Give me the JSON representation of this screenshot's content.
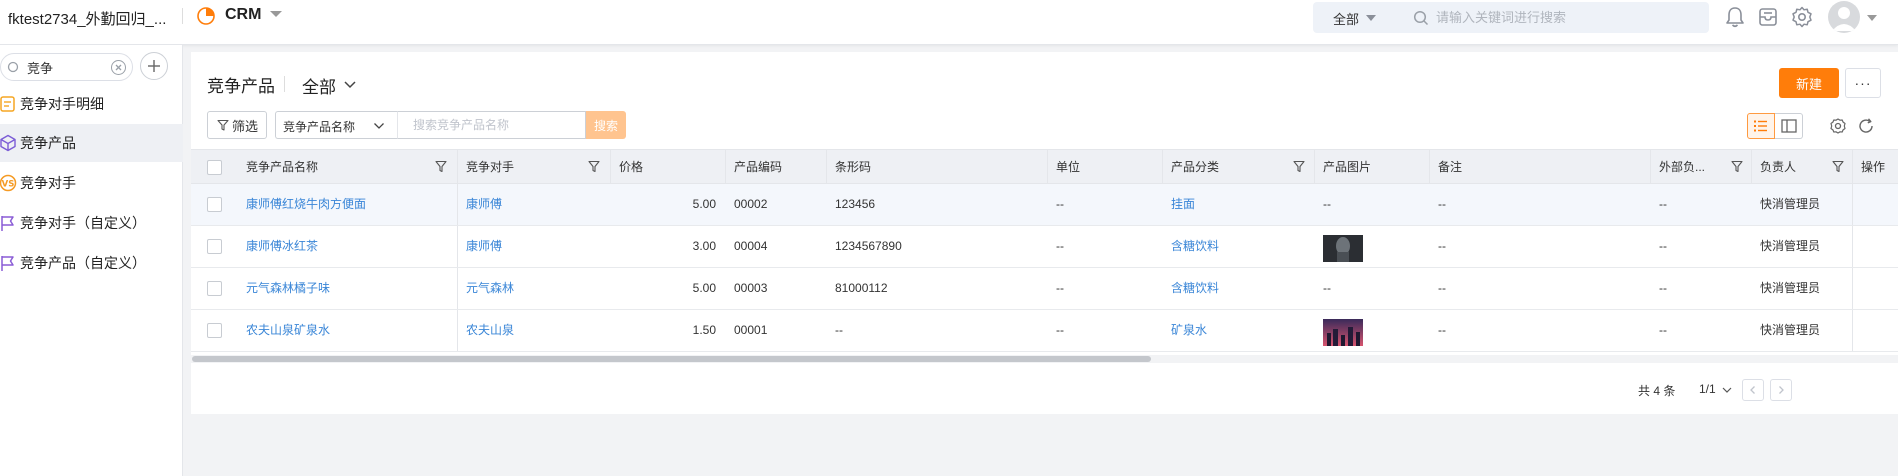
{
  "header": {
    "app_name": "fktest2734_外勤回归_...",
    "crm_title": "CRM",
    "search_scope": "全部",
    "search_placeholder": "请输入关键词进行搜索"
  },
  "sidebar": {
    "search_value": "竞争",
    "items": [
      {
        "label": "竞争对手明细",
        "icon": "document-list-icon",
        "color": "#f5a623"
      },
      {
        "label": "竞争产品",
        "icon": "cube-icon",
        "color": "#7b5cd6"
      },
      {
        "label": "竞争对手",
        "icon": "vs-badge-icon",
        "color": "#f59a23"
      },
      {
        "label": "竞争对手（自定义）",
        "icon": "flag-icon",
        "color": "#8a5cd6"
      },
      {
        "label": "竞争产品（自定义）",
        "icon": "flag-icon",
        "color": "#8a5cd6"
      }
    ]
  },
  "main": {
    "title": "竞争产品",
    "view": "全部",
    "new_label": "新建",
    "more_label": "···",
    "filter_label": "筛选",
    "search_field": "竞争产品名称",
    "search_placeholder": "搜索竞争产品名称",
    "search_button": "搜索"
  },
  "table": {
    "columns": [
      "竞争产品名称",
      "竞争对手",
      "价格",
      "产品编码",
      "条形码",
      "单位",
      "产品分类",
      "产品图片",
      "备注",
      "外部负...",
      "负责人",
      "操作"
    ],
    "rows": [
      {
        "name": "康师傅红烧牛肉方便面",
        "rival": "康师傅",
        "price": "5.00",
        "code": "00002",
        "barcode": "123456",
        "unit": "--",
        "category": "挂面",
        "image": "--",
        "note": "--",
        "external": "--",
        "owner": "快消管理员"
      },
      {
        "name": "康师傅冰红茶",
        "rival": "康师傅",
        "price": "3.00",
        "code": "00004",
        "barcode": "1234567890",
        "unit": "--",
        "category": "含糖饮料",
        "image": "",
        "note": "--",
        "external": "--",
        "owner": "快消管理员"
      },
      {
        "name": "元气森林橘子味",
        "rival": "元气森林",
        "price": "5.00",
        "code": "00003",
        "barcode": "81000112",
        "unit": "--",
        "category": "含糖饮料",
        "image": "--",
        "note": "--",
        "external": "--",
        "owner": "快消管理员"
      },
      {
        "name": "农夫山泉矿泉水",
        "rival": "农夫山泉",
        "price": "1.50",
        "code": "00001",
        "barcode": "--",
        "unit": "--",
        "category": "矿泉水",
        "image": "",
        "note": "--",
        "external": "--",
        "owner": "快消管理员"
      }
    ]
  },
  "pager": {
    "total": "共 4 条",
    "page": "1/1"
  },
  "colors": {
    "accent": "#ff7d0a",
    "link": "#3a86d7"
  }
}
